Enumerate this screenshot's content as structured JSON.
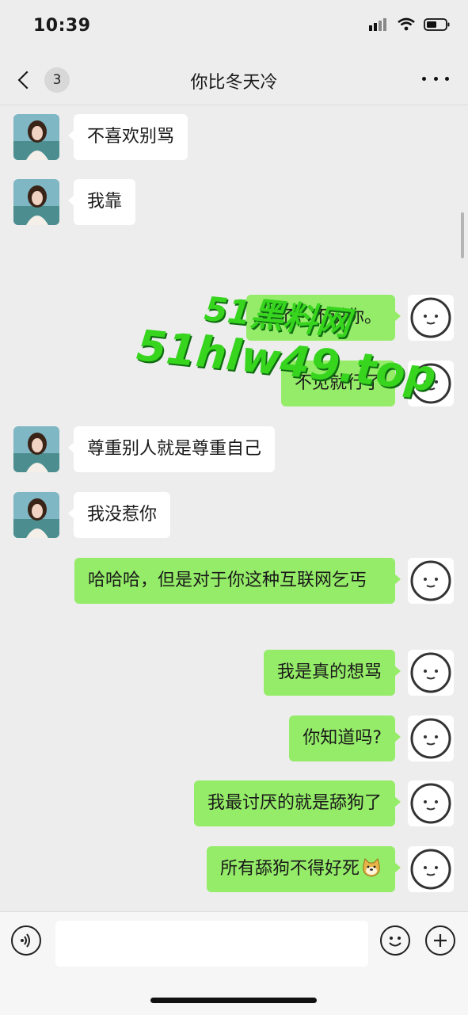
{
  "status": {
    "time": "10:39"
  },
  "header": {
    "title": "你比冬天冷",
    "unread_count": "3"
  },
  "watermark": {
    "line1": "51黑料网",
    "line2": "51hlw49.top"
  },
  "messages": [
    {
      "side": "left",
      "text": "不喜欢别骂"
    },
    {
      "side": "left",
      "text": "我靠"
    },
    {
      "side": "right",
      "text": "算了，不说你。"
    },
    {
      "side": "right",
      "text": "不见就行了"
    },
    {
      "side": "left",
      "text": "尊重别人就是尊重自己"
    },
    {
      "side": "left",
      "text": "我没惹你"
    },
    {
      "side": "right",
      "text": "哈哈哈，但是对于你这种互联网乞丐"
    },
    {
      "side": "right",
      "text": "我是真的想骂"
    },
    {
      "side": "right",
      "text": "你知道吗?"
    },
    {
      "side": "right",
      "text": "我最讨厌的就是舔狗了"
    },
    {
      "side": "right",
      "text": "所有舔狗不得好死",
      "emoji": "doge-emoji"
    }
  ],
  "input": {
    "value": "",
    "placeholder": ""
  },
  "icons": {
    "back": "chevron-left-icon",
    "more": "more-dots-icon",
    "voice": "voice-icon",
    "emoji": "emoji-icon",
    "plus": "plus-icon",
    "signal": "signal-icon",
    "wifi": "wifi-icon",
    "battery": "battery-icon"
  },
  "colors": {
    "background": "#ededed",
    "sent_bubble": "#95ec69",
    "received_bubble": "#ffffff",
    "watermark": "#37d51e"
  }
}
